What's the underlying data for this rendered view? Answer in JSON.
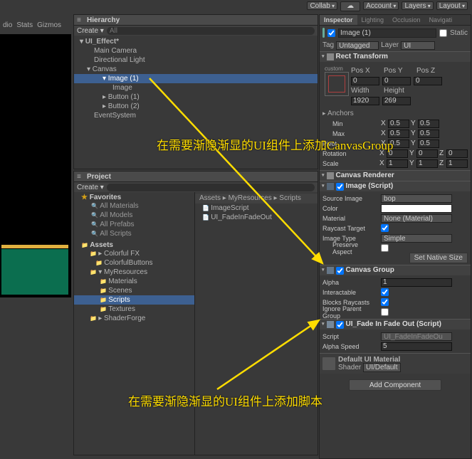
{
  "topbar": {
    "collab": "Collab",
    "account": "Account",
    "layers": "Layers",
    "layout": "Layout"
  },
  "leftstub": {
    "t1": "dio",
    "t2": "Stats",
    "t3": "Gizmos"
  },
  "hierarchy": {
    "title": "Hierarchy",
    "create": "Create",
    "search": "All",
    "items": [
      {
        "label": "UI_Effect*",
        "indent": 8,
        "bold": true,
        "open": true
      },
      {
        "label": "Main Camera",
        "indent": 28
      },
      {
        "label": "Directional Light",
        "indent": 28
      },
      {
        "label": "Canvas",
        "indent": 18,
        "open": true
      },
      {
        "label": "Image (1)",
        "indent": 40,
        "sel": true,
        "open": true
      },
      {
        "label": "Image",
        "indent": 54
      },
      {
        "label": "Button (1)",
        "indent": 40,
        "arrow": true
      },
      {
        "label": "Button (2)",
        "indent": 40,
        "arrow": true
      },
      {
        "label": "EventSystem",
        "indent": 28
      }
    ]
  },
  "project": {
    "title": "Project",
    "create": "Create",
    "favorites_hdr": "Favorites",
    "favs": [
      "All Materials",
      "All Models",
      "All Prefabs",
      "All Scripts"
    ],
    "assets_hdr": "Assets",
    "folders": [
      {
        "label": "Colorful FX",
        "indent": 22,
        "arrow": true
      },
      {
        "label": "ColorfulButtons",
        "indent": 30
      },
      {
        "label": "MyResources",
        "indent": 22,
        "open": true
      },
      {
        "label": "Materials",
        "indent": 36
      },
      {
        "label": "Scenes",
        "indent": 36
      },
      {
        "label": "Scripts",
        "indent": 36,
        "sel": true
      },
      {
        "label": "Textures",
        "indent": 36
      },
      {
        "label": "ShaderForge",
        "indent": 22,
        "arrow": true
      }
    ],
    "crumb": "Assets ▸ MyResources ▸ Scripts",
    "files": [
      "ImageScript",
      "UI_FadeInFadeOut"
    ]
  },
  "inspector": {
    "tabs": [
      "Inspector",
      "Lighting",
      "Occlusion",
      "Navigati"
    ],
    "go_name": "Image (1)",
    "static": "Static",
    "tag_lbl": "Tag",
    "tag_val": "Untagged",
    "layer_lbl": "Layer",
    "layer_val": "UI",
    "rect": {
      "title": "Rect Transform",
      "custom": "custom",
      "posx_lbl": "Pos X",
      "posy_lbl": "Pos Y",
      "posz_lbl": "Pos Z",
      "posx": "0",
      "posy": "0",
      "posz": "0",
      "w_lbl": "Width",
      "h_lbl": "Height",
      "w": "1920",
      "h": "269",
      "anchors": "Anchors",
      "min": "Min",
      "max": "Max",
      "pivot": "Pivot",
      "minx": "0.5",
      "miny": "0.5",
      "maxx": "0.5",
      "maxy": "0.5",
      "pivx": "0.5",
      "pivy": "0.5",
      "rot": "Rotation",
      "scale": "Scale",
      "rx": "0",
      "ry": "0",
      "rz": "0",
      "sx": "1",
      "sy": "1",
      "sz": "1"
    },
    "canvasr": "Canvas Renderer",
    "img": {
      "title": "Image (Script)",
      "src_lbl": "Source Image",
      "src_val": "bop",
      "col_lbl": "Color",
      "mat_lbl": "Material",
      "mat_val": "None (Material)",
      "ray_lbl": "Raycast Target",
      "type_lbl": "Image Type",
      "type_val": "Simple",
      "preserve_lbl": "Preserve Aspect",
      "setnative": "Set Native Size"
    },
    "cg": {
      "title": "Canvas Group",
      "alpha_lbl": "Alpha",
      "alpha": "1",
      "inter_lbl": "Interactable",
      "block_lbl": "Blocks Raycasts",
      "ignore_lbl": "Ignore Parent Group"
    },
    "fade": {
      "title": "UI_Fade In Fade Out (Script)",
      "script_lbl": "Script",
      "script_val": "UI_FadeInFadeOu",
      "speed_lbl": "Alpha Speed",
      "speed": "5"
    },
    "mat": {
      "name": "Default UI Material",
      "shader_lbl": "Shader",
      "shader": "UI/Default"
    },
    "add": "Add Component"
  },
  "anno": {
    "a1": "在需要渐隐渐显的UI组件上添加CanvasGroup",
    "a2": "在需要渐隐渐显的UI组件上添加脚本"
  }
}
